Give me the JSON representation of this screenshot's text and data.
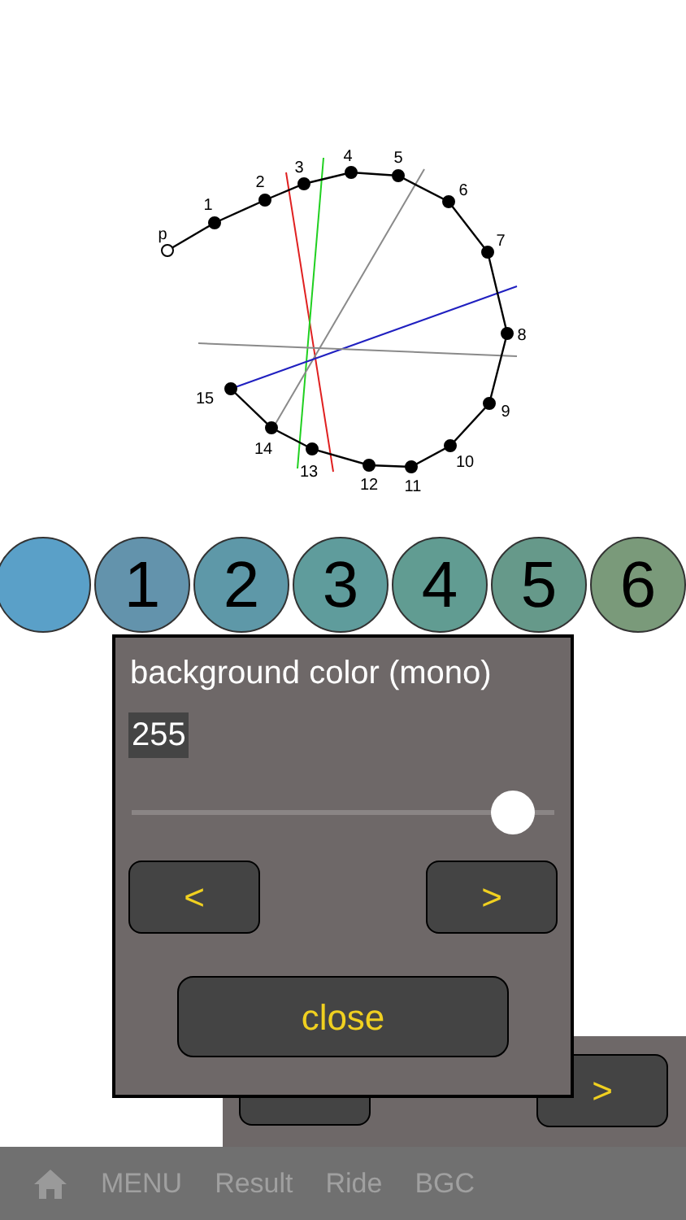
{
  "diagram": {
    "point_labels": [
      "p",
      "1",
      "2",
      "3",
      "4",
      "5",
      "6",
      "7",
      "8",
      "9",
      "10",
      "11",
      "12",
      "13",
      "14",
      "15"
    ]
  },
  "color_buttons": [
    {
      "color": "#5aa0c8"
    },
    {
      "label": "1",
      "color": "#6393ac"
    },
    {
      "label": "2",
      "color": "#5e98a8"
    },
    {
      "label": "3",
      "color": "#5f9c9c"
    },
    {
      "label": "4",
      "color": "#619c92"
    },
    {
      "label": "5",
      "color": "#66998a"
    },
    {
      "label": "6",
      "color": "#7a9a7a"
    }
  ],
  "background_panel": {
    "buttons": [
      ">"
    ]
  },
  "dialog": {
    "title": "background color (mono)",
    "value": "255",
    "slider": {
      "level": 0.95
    },
    "buttons": [
      "<",
      ">"
    ],
    "close": "close"
  },
  "bottom_bar": {
    "items": [
      "MENU",
      "Result",
      "Ride",
      "BGC"
    ]
  }
}
